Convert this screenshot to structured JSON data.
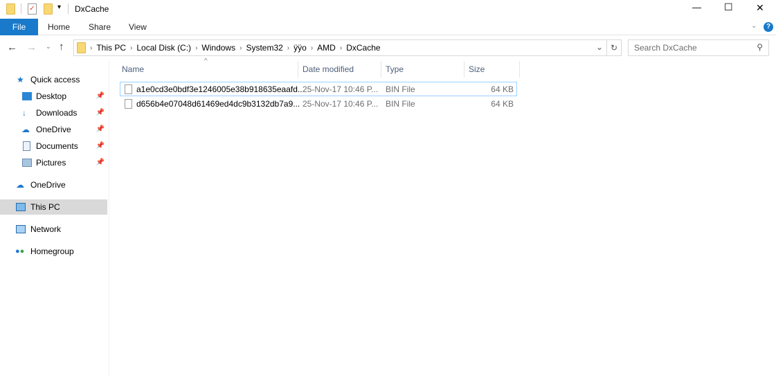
{
  "window": {
    "title": "DxCache",
    "controls": {
      "minimize": "—",
      "maximize": "☐",
      "close": "✕"
    }
  },
  "ribbon": {
    "tabs": [
      "File",
      "Home",
      "Share",
      "View"
    ],
    "help": "?"
  },
  "address": {
    "crumbs": [
      "This PC",
      "Local Disk (C:)",
      "Windows",
      "System32",
      "ÿÿo",
      "AMD",
      "DxCache"
    ]
  },
  "search": {
    "placeholder": "Search DxCache"
  },
  "sidebar": {
    "items": [
      {
        "label": "Quick access",
        "icon": "star-icon"
      },
      {
        "label": "Desktop",
        "icon": "desktop-icon",
        "pinned": true
      },
      {
        "label": "Downloads",
        "icon": "download-icon",
        "pinned": true
      },
      {
        "label": "OneDrive",
        "icon": "cloud-icon",
        "pinned": true
      },
      {
        "label": "Documents",
        "icon": "documents-icon",
        "pinned": true
      },
      {
        "label": "Pictures",
        "icon": "pictures-icon",
        "pinned": true
      },
      {
        "label": "OneDrive",
        "icon": "cloud-icon"
      },
      {
        "label": "This PC",
        "icon": "computer-icon",
        "selected": true
      },
      {
        "label": "Network",
        "icon": "network-icon"
      },
      {
        "label": "Homegroup",
        "icon": "homegroup-icon"
      }
    ]
  },
  "columns": [
    "Name",
    "Date modified",
    "Type",
    "Size"
  ],
  "files": [
    {
      "name": "a1e0cd3e0bdf3e1246005e38b918635eaafd...",
      "date": "25-Nov-17 10:46 P...",
      "type": "BIN File",
      "size": "64 KB"
    },
    {
      "name": "d656b4e07048d61469ed4dc9b3132db7a9...",
      "date": "25-Nov-17 10:46 P...",
      "type": "BIN File",
      "size": "64 KB"
    }
  ],
  "colors": {
    "accent": "#1979ca",
    "selected": "#d9d9d9"
  }
}
